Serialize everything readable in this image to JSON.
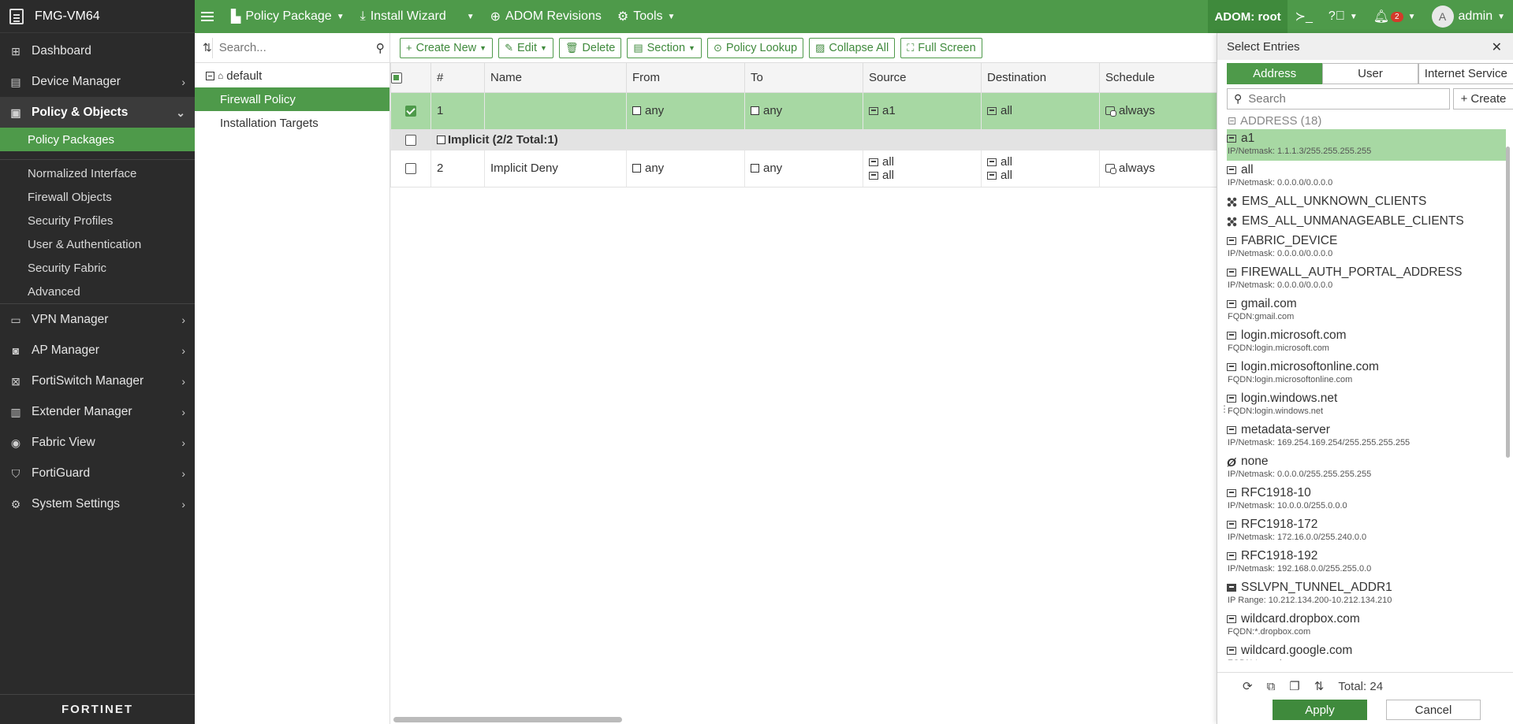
{
  "app": {
    "device_name": "FMG-VM64",
    "footer_logo": "FORTINET"
  },
  "leftnav": {
    "items": [
      {
        "label": "Dashboard",
        "icon": "dashboard-icon"
      },
      {
        "label": "Device Manager",
        "icon": "device-icon"
      },
      {
        "label": "Policy & Objects",
        "icon": "policy-icon"
      },
      {
        "label": "VPN Manager",
        "icon": "vpn-icon"
      },
      {
        "label": "AP Manager",
        "icon": "ap-icon"
      },
      {
        "label": "FortiSwitch Manager",
        "icon": "switch-icon"
      },
      {
        "label": "Extender Manager",
        "icon": "extender-icon"
      },
      {
        "label": "Fabric View",
        "icon": "fabric-icon"
      },
      {
        "label": "FortiGuard",
        "icon": "fortiguard-icon"
      },
      {
        "label": "System Settings",
        "icon": "gear-icon"
      }
    ],
    "policy_sub": [
      "Policy Packages",
      "Normalized Interface",
      "Firewall Objects",
      "Security Profiles",
      "User & Authentication",
      "Security Fabric",
      "Advanced"
    ]
  },
  "topbar": {
    "policy_package": "Policy Package",
    "install_wizard": "Install Wizard",
    "adom_revisions": "ADOM Revisions",
    "tools": "Tools",
    "adom": "ADOM: root",
    "notifications": "2",
    "avatar_letter": "A",
    "user": "admin"
  },
  "tree": {
    "search_placeholder": "Search...",
    "root": "default",
    "items": [
      "Firewall Policy",
      "Installation Targets"
    ]
  },
  "toolbar": {
    "create_new": "Create New",
    "edit": "Edit",
    "delete": "Delete",
    "section": "Section",
    "policy_lookup": "Policy Lookup",
    "collapse_all": "Collapse All",
    "full_screen": "Full Screen"
  },
  "grid": {
    "columns": [
      "#",
      "Name",
      "From",
      "To",
      "Source",
      "Destination",
      "Schedule"
    ],
    "row1": {
      "num": "1",
      "name": "",
      "from": "any",
      "to": "any",
      "source": "a1",
      "destination": "all",
      "schedule": "always"
    },
    "section": "Implicit (2/2 Total:1)",
    "row2": {
      "num": "2",
      "name": "Implicit Deny",
      "from": "any",
      "to": "any",
      "source1": "all",
      "source2": "all",
      "dest1": "all",
      "dest2": "all",
      "schedule": "always"
    }
  },
  "entries": {
    "title": "Select Entries",
    "tabs": [
      "Address",
      "User",
      "Internet Service"
    ],
    "search_placeholder": "Search",
    "create": "Create",
    "group": "ADDRESS (18)",
    "items": [
      {
        "name": "a1",
        "detail": "IP/Netmask: 1.1.1.3/255.255.255.255",
        "icon": "address-icon"
      },
      {
        "name": "all",
        "detail": "IP/Netmask: 0.0.0.0/0.0.0.0",
        "icon": "address-icon"
      },
      {
        "name": "EMS_ALL_UNKNOWN_CLIENTS",
        "detail": "",
        "icon": "cluster-icon"
      },
      {
        "name": "EMS_ALL_UNMANAGEABLE_CLIENTS",
        "detail": "",
        "icon": "cluster-icon"
      },
      {
        "name": "FABRIC_DEVICE",
        "detail": "IP/Netmask: 0.0.0.0/0.0.0.0",
        "icon": "address-icon"
      },
      {
        "name": "FIREWALL_AUTH_PORTAL_ADDRESS",
        "detail": "IP/Netmask: 0.0.0.0/0.0.0.0",
        "icon": "address-icon"
      },
      {
        "name": "gmail.com",
        "detail": "FQDN:gmail.com",
        "icon": "address-icon"
      },
      {
        "name": "login.microsoft.com",
        "detail": "FQDN:login.microsoft.com",
        "icon": "address-icon"
      },
      {
        "name": "login.microsoftonline.com",
        "detail": "FQDN:login.microsoftonline.com",
        "icon": "address-icon"
      },
      {
        "name": "login.windows.net",
        "detail": "FQDN:login.windows.net",
        "icon": "address-icon"
      },
      {
        "name": "metadata-server",
        "detail": "IP/Netmask: 169.254.169.254/255.255.255.255",
        "icon": "address-icon"
      },
      {
        "name": "none",
        "detail": "IP/Netmask: 0.0.0.0/255.255.255.255",
        "icon": "none-icon"
      },
      {
        "name": "RFC1918-10",
        "detail": "IP/Netmask: 10.0.0.0/255.0.0.0",
        "icon": "address-icon"
      },
      {
        "name": "RFC1918-172",
        "detail": "IP/Netmask: 172.16.0.0/255.240.0.0",
        "icon": "address-icon"
      },
      {
        "name": "RFC1918-192",
        "detail": "IP/Netmask: 192.168.0.0/255.255.0.0",
        "icon": "address-icon"
      },
      {
        "name": "SSLVPN_TUNNEL_ADDR1",
        "detail": "IP Range: 10.212.134.200-10.212.134.210",
        "icon": "range-icon"
      },
      {
        "name": "wildcard.dropbox.com",
        "detail": "FQDN:*.dropbox.com",
        "icon": "address-icon"
      },
      {
        "name": "wildcard.google.com",
        "detail": "FQDN:*.google.com",
        "icon": "address-icon"
      }
    ],
    "total": "Total: 24",
    "apply": "Apply",
    "cancel": "Cancel"
  },
  "colors": {
    "brand_green": "#4e9a4a",
    "selected_row": "#a7d8a3",
    "nav_bg": "#2b2b2b"
  }
}
